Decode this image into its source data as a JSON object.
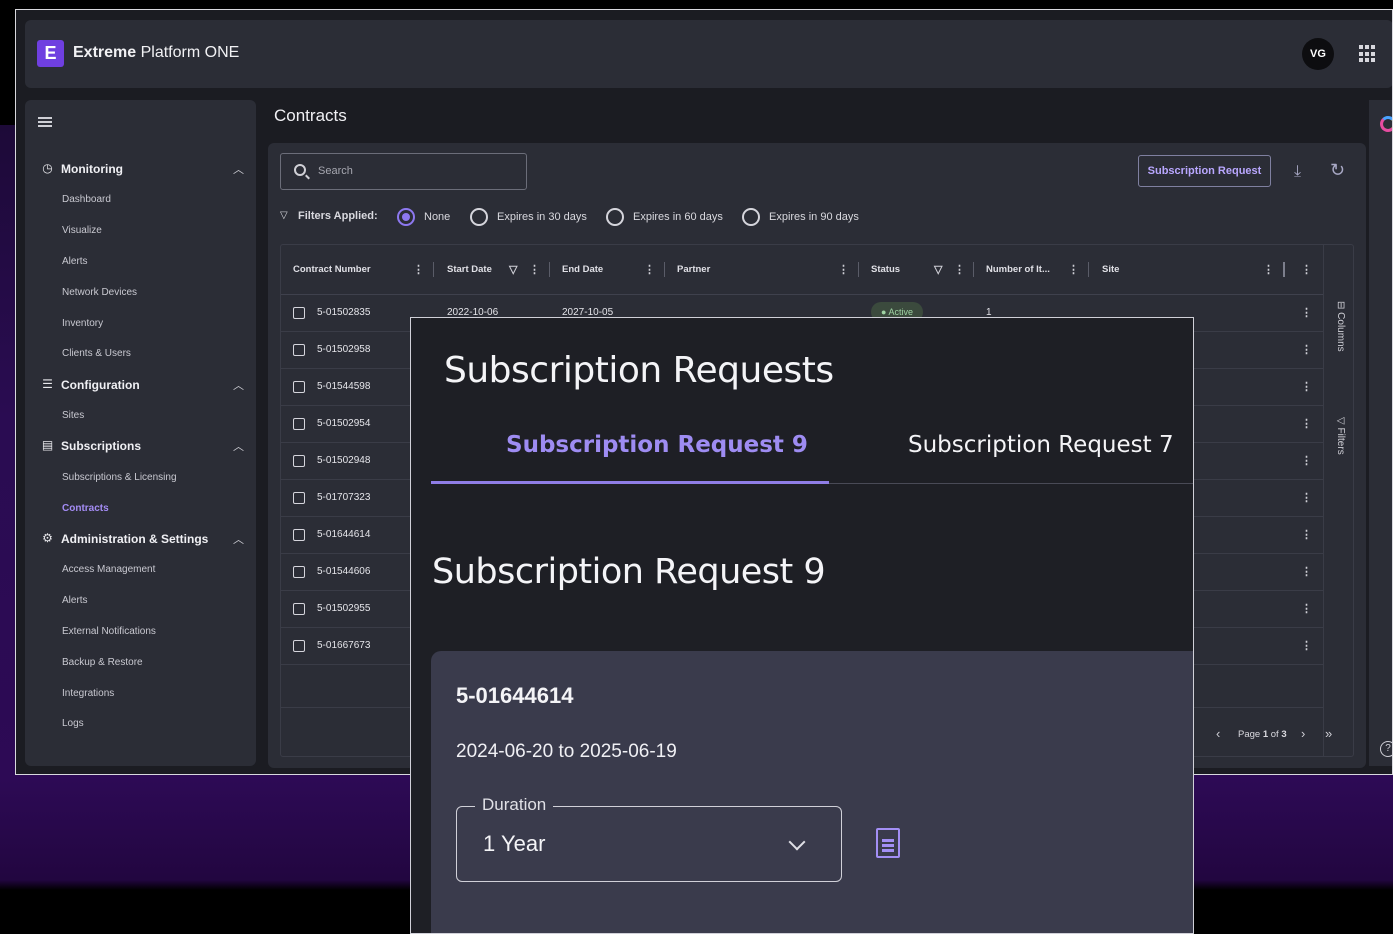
{
  "app": {
    "brand_bold": "Extreme",
    "brand_rest": " Platform ONE",
    "logo_letter": "E",
    "user_initials": "VG"
  },
  "sidebar": {
    "sections": [
      {
        "label": "Monitoring",
        "icon": "gauge-icon",
        "items": [
          "Dashboard",
          "Visualize",
          "Alerts",
          "Network Devices",
          "Inventory",
          "Clients & Users"
        ]
      },
      {
        "label": "Configuration",
        "icon": "list-icon",
        "items": [
          "Sites"
        ]
      },
      {
        "label": "Subscriptions",
        "icon": "document-icon",
        "items": [
          "Subscriptions & Licensing",
          "Contracts"
        ]
      },
      {
        "label": "Administration & Settings",
        "icon": "gear-icon",
        "items": [
          "Access Management",
          "Alerts",
          "External Notifications",
          "Backup & Restore",
          "Integrations",
          "Logs"
        ]
      }
    ],
    "active_item": "Contracts"
  },
  "page": {
    "title": "Contracts",
    "search_placeholder": "Search",
    "subscription_request_button": "Subscription Request",
    "filters_label": "Filters Applied:",
    "filter_options": [
      "None",
      "Expires in 30 days",
      "Expires in 60 days",
      "Expires in 90 days"
    ],
    "selected_filter": "None"
  },
  "table": {
    "columns": [
      "Contract Number",
      "Start Date",
      "End Date",
      "Partner",
      "Status",
      "Number of It...",
      "Site"
    ],
    "rows": [
      {
        "contract": "5-01502835",
        "start": "2022-10-06",
        "end": "2027-10-05",
        "status": "Active",
        "items": "1"
      },
      {
        "contract": "5-01502958"
      },
      {
        "contract": "5-01544598"
      },
      {
        "contract": "5-01502954"
      },
      {
        "contract": "5-01502948"
      },
      {
        "contract": "5-01707323"
      },
      {
        "contract": "5-01644614"
      },
      {
        "contract": "5-01544606"
      },
      {
        "contract": "5-01502955"
      },
      {
        "contract": "5-01667673"
      }
    ],
    "rail": {
      "columns": "Columns",
      "filters": "Filters"
    },
    "pagination": {
      "page": "1",
      "total": "3",
      "prefix": "Page",
      "of": "of"
    }
  },
  "modal": {
    "title": "Subscription Requests",
    "tabs": [
      "Subscription Request 9",
      "Subscription Request 7"
    ],
    "active_tab": "Subscription Request 9",
    "heading": "Subscription Request 9",
    "card": {
      "contract_number": "5-01644614",
      "date_range": "2024-06-20 to 2025-06-19",
      "duration_label": "Duration",
      "duration_value": "1 Year"
    }
  },
  "colors": {
    "accent": "#8d78f0",
    "active_tab": "#9e8cf2",
    "panel": "#2b2d36"
  }
}
